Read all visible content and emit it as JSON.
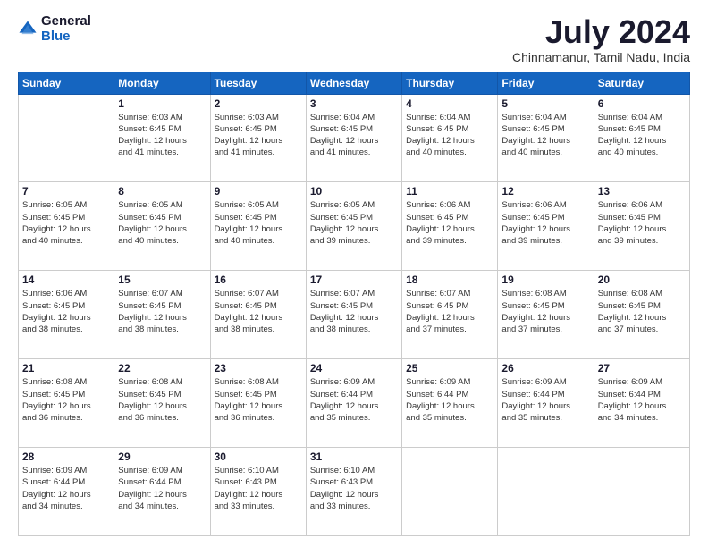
{
  "logo": {
    "general": "General",
    "blue": "Blue"
  },
  "header": {
    "month": "July 2024",
    "location": "Chinnamanur, Tamil Nadu, India"
  },
  "days_of_week": [
    "Sunday",
    "Monday",
    "Tuesday",
    "Wednesday",
    "Thursday",
    "Friday",
    "Saturday"
  ],
  "weeks": [
    [
      {
        "day": "",
        "info": ""
      },
      {
        "day": "1",
        "info": "Sunrise: 6:03 AM\nSunset: 6:45 PM\nDaylight: 12 hours\nand 41 minutes."
      },
      {
        "day": "2",
        "info": "Sunrise: 6:03 AM\nSunset: 6:45 PM\nDaylight: 12 hours\nand 41 minutes."
      },
      {
        "day": "3",
        "info": "Sunrise: 6:04 AM\nSunset: 6:45 PM\nDaylight: 12 hours\nand 41 minutes."
      },
      {
        "day": "4",
        "info": "Sunrise: 6:04 AM\nSunset: 6:45 PM\nDaylight: 12 hours\nand 40 minutes."
      },
      {
        "day": "5",
        "info": "Sunrise: 6:04 AM\nSunset: 6:45 PM\nDaylight: 12 hours\nand 40 minutes."
      },
      {
        "day": "6",
        "info": "Sunrise: 6:04 AM\nSunset: 6:45 PM\nDaylight: 12 hours\nand 40 minutes."
      }
    ],
    [
      {
        "day": "7",
        "info": "Sunrise: 6:05 AM\nSunset: 6:45 PM\nDaylight: 12 hours\nand 40 minutes."
      },
      {
        "day": "8",
        "info": "Sunrise: 6:05 AM\nSunset: 6:45 PM\nDaylight: 12 hours\nand 40 minutes."
      },
      {
        "day": "9",
        "info": "Sunrise: 6:05 AM\nSunset: 6:45 PM\nDaylight: 12 hours\nand 40 minutes."
      },
      {
        "day": "10",
        "info": "Sunrise: 6:05 AM\nSunset: 6:45 PM\nDaylight: 12 hours\nand 39 minutes."
      },
      {
        "day": "11",
        "info": "Sunrise: 6:06 AM\nSunset: 6:45 PM\nDaylight: 12 hours\nand 39 minutes."
      },
      {
        "day": "12",
        "info": "Sunrise: 6:06 AM\nSunset: 6:45 PM\nDaylight: 12 hours\nand 39 minutes."
      },
      {
        "day": "13",
        "info": "Sunrise: 6:06 AM\nSunset: 6:45 PM\nDaylight: 12 hours\nand 39 minutes."
      }
    ],
    [
      {
        "day": "14",
        "info": "Sunrise: 6:06 AM\nSunset: 6:45 PM\nDaylight: 12 hours\nand 38 minutes."
      },
      {
        "day": "15",
        "info": "Sunrise: 6:07 AM\nSunset: 6:45 PM\nDaylight: 12 hours\nand 38 minutes."
      },
      {
        "day": "16",
        "info": "Sunrise: 6:07 AM\nSunset: 6:45 PM\nDaylight: 12 hours\nand 38 minutes."
      },
      {
        "day": "17",
        "info": "Sunrise: 6:07 AM\nSunset: 6:45 PM\nDaylight: 12 hours\nand 38 minutes."
      },
      {
        "day": "18",
        "info": "Sunrise: 6:07 AM\nSunset: 6:45 PM\nDaylight: 12 hours\nand 37 minutes."
      },
      {
        "day": "19",
        "info": "Sunrise: 6:08 AM\nSunset: 6:45 PM\nDaylight: 12 hours\nand 37 minutes."
      },
      {
        "day": "20",
        "info": "Sunrise: 6:08 AM\nSunset: 6:45 PM\nDaylight: 12 hours\nand 37 minutes."
      }
    ],
    [
      {
        "day": "21",
        "info": "Sunrise: 6:08 AM\nSunset: 6:45 PM\nDaylight: 12 hours\nand 36 minutes."
      },
      {
        "day": "22",
        "info": "Sunrise: 6:08 AM\nSunset: 6:45 PM\nDaylight: 12 hours\nand 36 minutes."
      },
      {
        "day": "23",
        "info": "Sunrise: 6:08 AM\nSunset: 6:45 PM\nDaylight: 12 hours\nand 36 minutes."
      },
      {
        "day": "24",
        "info": "Sunrise: 6:09 AM\nSunset: 6:44 PM\nDaylight: 12 hours\nand 35 minutes."
      },
      {
        "day": "25",
        "info": "Sunrise: 6:09 AM\nSunset: 6:44 PM\nDaylight: 12 hours\nand 35 minutes."
      },
      {
        "day": "26",
        "info": "Sunrise: 6:09 AM\nSunset: 6:44 PM\nDaylight: 12 hours\nand 35 minutes."
      },
      {
        "day": "27",
        "info": "Sunrise: 6:09 AM\nSunset: 6:44 PM\nDaylight: 12 hours\nand 34 minutes."
      }
    ],
    [
      {
        "day": "28",
        "info": "Sunrise: 6:09 AM\nSunset: 6:44 PM\nDaylight: 12 hours\nand 34 minutes."
      },
      {
        "day": "29",
        "info": "Sunrise: 6:09 AM\nSunset: 6:44 PM\nDaylight: 12 hours\nand 34 minutes."
      },
      {
        "day": "30",
        "info": "Sunrise: 6:10 AM\nSunset: 6:43 PM\nDaylight: 12 hours\nand 33 minutes."
      },
      {
        "day": "31",
        "info": "Sunrise: 6:10 AM\nSunset: 6:43 PM\nDaylight: 12 hours\nand 33 minutes."
      },
      {
        "day": "",
        "info": ""
      },
      {
        "day": "",
        "info": ""
      },
      {
        "day": "",
        "info": ""
      }
    ]
  ]
}
